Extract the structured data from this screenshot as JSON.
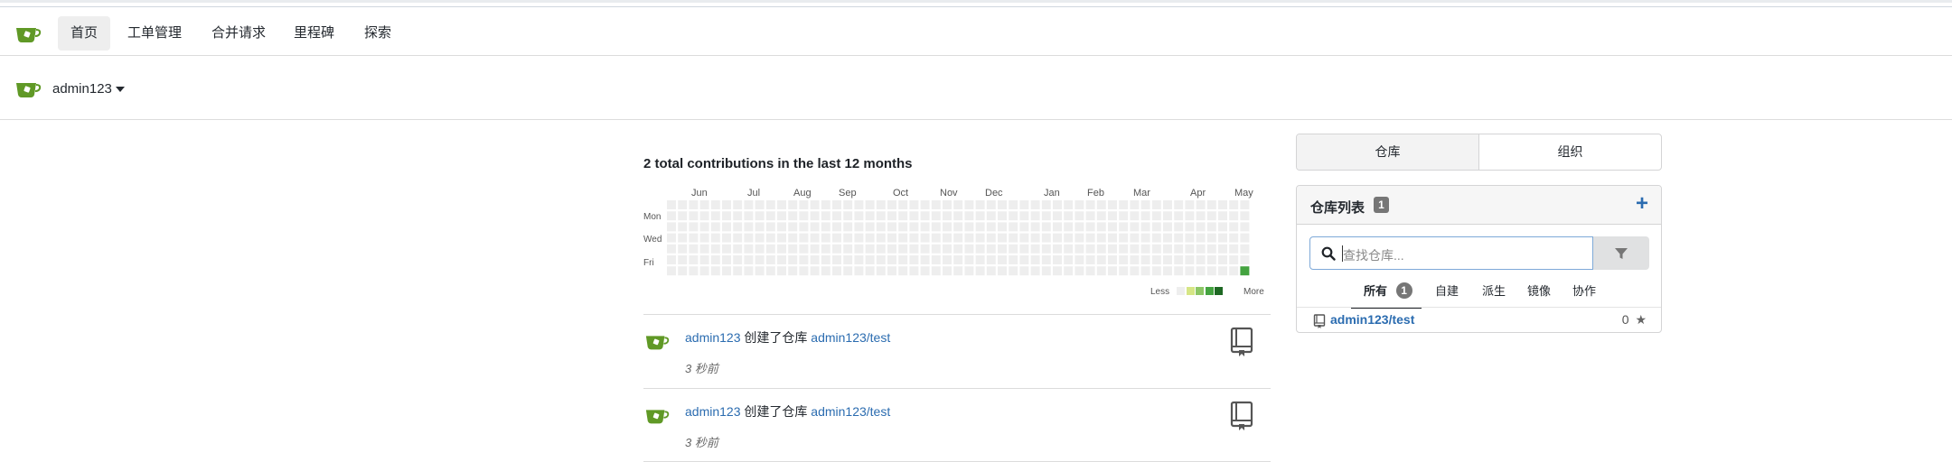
{
  "brand": {
    "color": "#609926",
    "logo": "gitea-teacup-icon"
  },
  "nav": {
    "items": [
      {
        "label": "首页",
        "active": true
      },
      {
        "label": "工单管理",
        "active": false
      },
      {
        "label": "合并请求",
        "active": false
      },
      {
        "label": "里程碑",
        "active": false
      },
      {
        "label": "探索",
        "active": false
      }
    ]
  },
  "context": {
    "username": "admin123"
  },
  "heatmap": {
    "title": "2 total contributions in the last 12 months",
    "months": [
      "Jun",
      "Jul",
      "Aug",
      "Sep",
      "Oct",
      "Nov",
      "Dec",
      "Jan",
      "Feb",
      "Mar",
      "Apr",
      "May"
    ],
    "days": [
      "Mon",
      "Wed",
      "Fri"
    ],
    "legend_less": "Less",
    "legend_more": "More",
    "empty_color": "#eeeeee",
    "scale_colors": [
      "#eeeeee",
      "#d6e685",
      "#8cc665",
      "#44a340",
      "#1e6823"
    ],
    "contributions": 2
  },
  "feed": [
    {
      "user": "admin123",
      "action": " 创建了仓库 ",
      "repo": "admin123/test",
      "time": "3 秒前"
    },
    {
      "user": "admin123",
      "action": " 创建了仓库 ",
      "repo": "admin123/test",
      "time": "3 秒前"
    }
  ],
  "sidebar": {
    "tabs": [
      {
        "label": "仓库",
        "active": true
      },
      {
        "label": "组织",
        "active": false
      }
    ],
    "repo_list": {
      "title": "仓库列表",
      "count": "1",
      "search_placeholder": "查找仓库...",
      "filters": [
        {
          "label": "所有",
          "count": "1",
          "active": true
        },
        {
          "label": "自建"
        },
        {
          "label": "派生"
        },
        {
          "label": "镜像"
        },
        {
          "label": "协作"
        }
      ],
      "repos": [
        {
          "name": "admin123/test",
          "stars": "0"
        }
      ]
    }
  }
}
